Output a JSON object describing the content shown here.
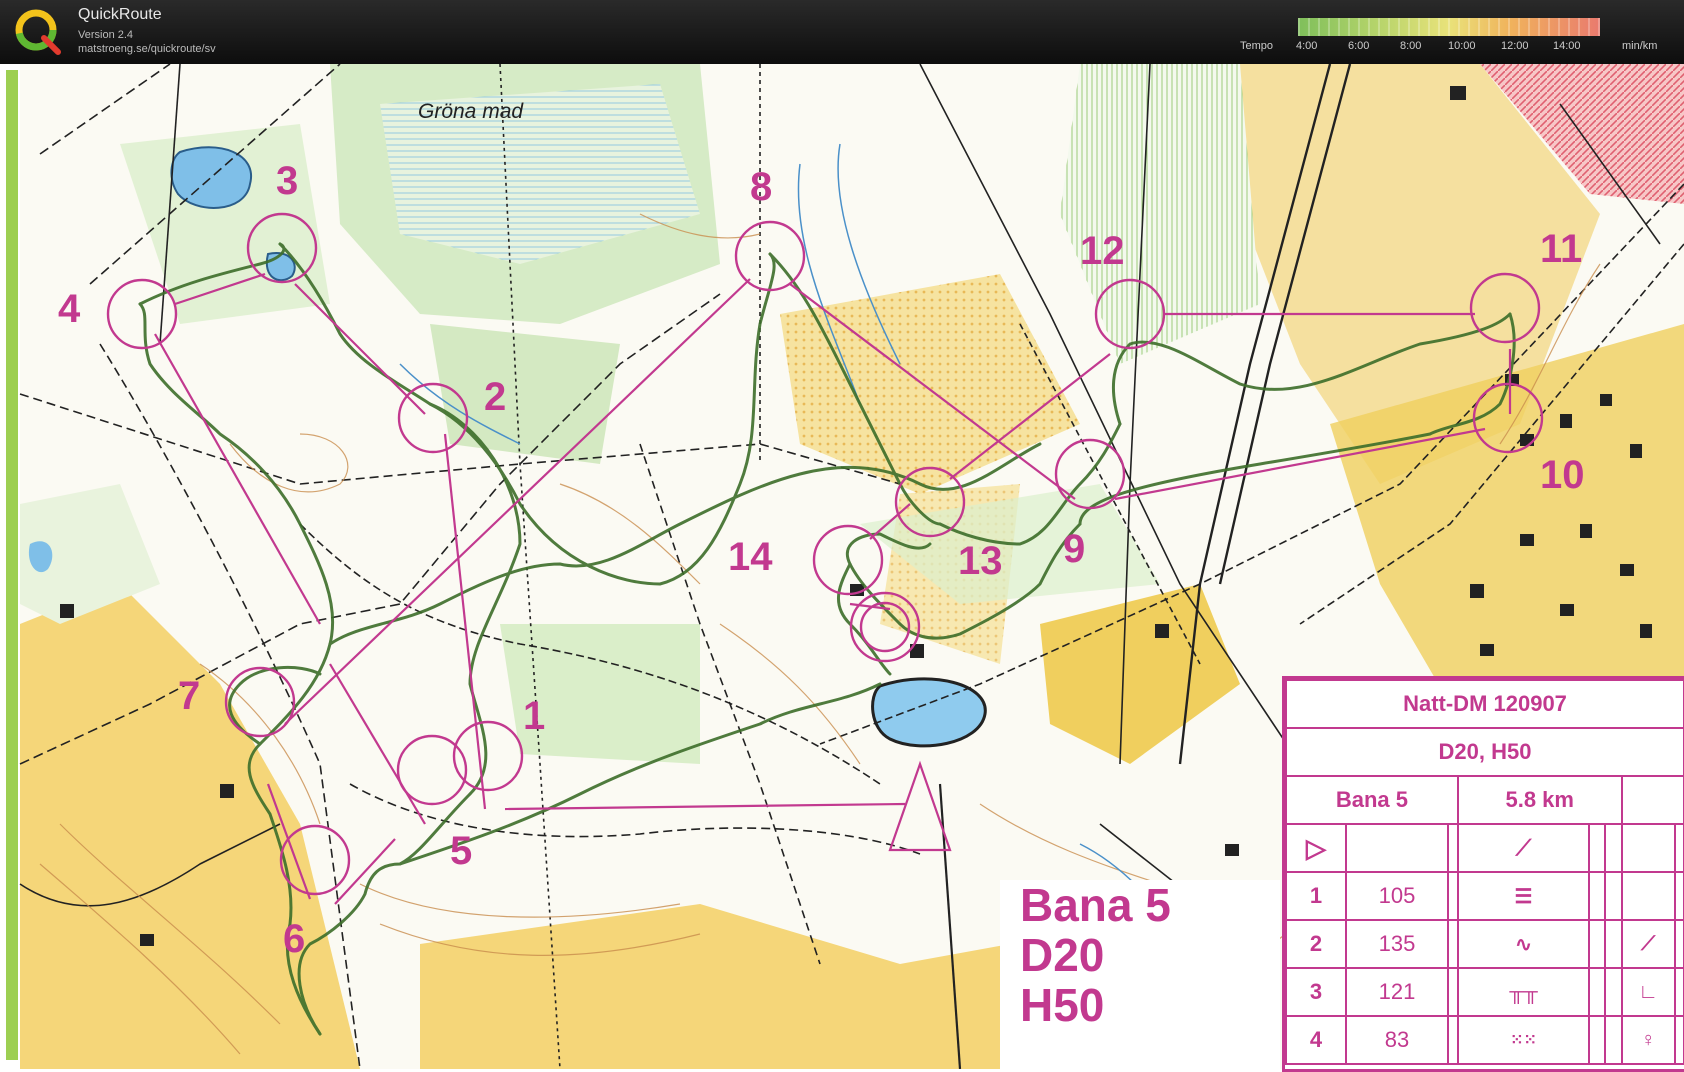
{
  "app": {
    "title": "QuickRoute",
    "version": "Version 2.4",
    "url": "matstroeng.se/quickroute/sv"
  },
  "tempo_scale": {
    "label": "Tempo",
    "ticks": [
      "4:00",
      "6:00",
      "8:00",
      "10:00",
      "12:00",
      "14:00"
    ],
    "unit": "min/km"
  },
  "map": {
    "place_name": "Gröna mad",
    "controls": [
      "1",
      "2",
      "3",
      "4",
      "5",
      "6",
      "7",
      "8",
      "9",
      "10",
      "11",
      "12",
      "13",
      "14"
    ],
    "course_label": [
      "Bana 5",
      "D20",
      "H50"
    ]
  },
  "control_card": {
    "event": "Natt-DM 120907",
    "classes": "D20, H50",
    "course": "Bana 5",
    "length": "5.8 km",
    "rows": [
      {
        "num": "1",
        "code": "105"
      },
      {
        "num": "2",
        "code": "135"
      },
      {
        "num": "3",
        "code": "121"
      },
      {
        "num": "4",
        "code": "83"
      }
    ]
  },
  "colors": {
    "course": "#c2398f",
    "route": "#3d6e2a",
    "open_land": "#f3cf63",
    "forest": "#ffffff",
    "green_vegetation": "#bfe0a6",
    "water": "#7fbfe8"
  }
}
